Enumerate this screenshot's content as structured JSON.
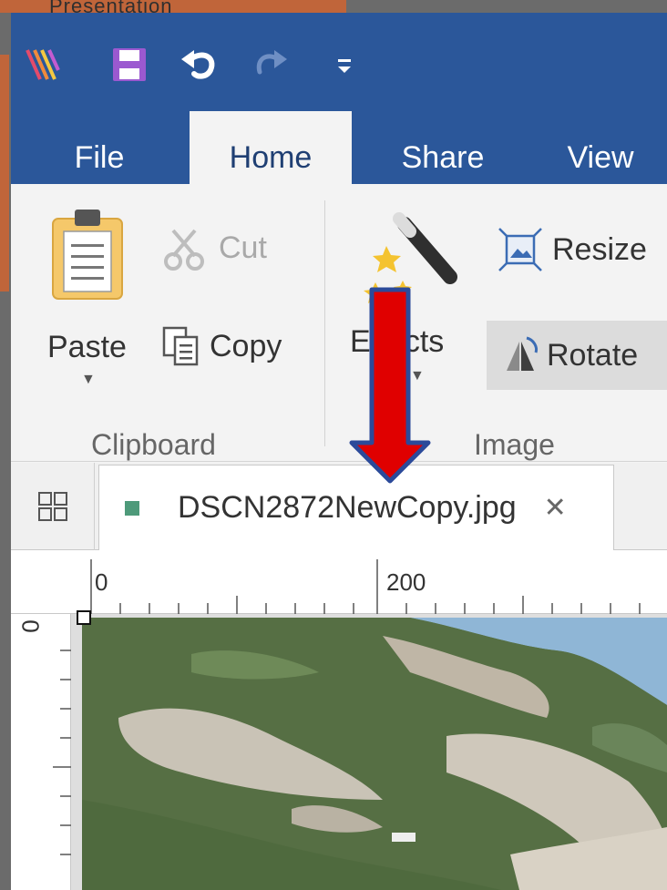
{
  "behind_window": {
    "title_fragment": "Presentation"
  },
  "quick_access": {
    "app_icon": "app-logo-icon",
    "save_icon": "save-icon",
    "undo_icon": "undo-icon",
    "redo_icon": "redo-icon",
    "more_icon": "customize-qat-icon"
  },
  "tabs": [
    {
      "label": "File"
    },
    {
      "label": "Home",
      "active": true
    },
    {
      "label": "Share"
    },
    {
      "label": "View"
    }
  ],
  "ribbon": {
    "clipboard": {
      "group_label": "Clipboard",
      "paste_label": "Paste",
      "cut_label": "Cut",
      "copy_label": "Copy"
    },
    "image": {
      "group_label": "Image",
      "effects_label": "Effects",
      "resize_label": "Resize",
      "rotate_label": "Rotate"
    }
  },
  "document_tab": {
    "filename": "DSCN2872NewCopy.jpg",
    "close_glyph": "✕"
  },
  "rulers": {
    "top_labels": [
      "0",
      "200"
    ],
    "left_label": "0"
  },
  "colors": {
    "title_bar": "#2b579a",
    "ribbon_bg": "#f3f3f3",
    "annotation_arrow": "#e00000",
    "arrow_outline": "#2b4a9a",
    "doc_tab_dot": "#4e9a7a"
  }
}
